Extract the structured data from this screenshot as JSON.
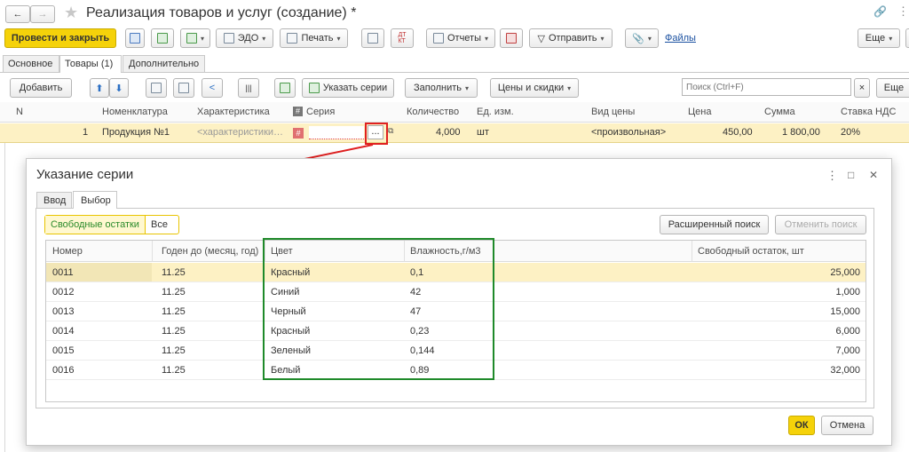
{
  "window": {
    "title": "Реализация товаров и услуг (создание) *"
  },
  "toolbar": {
    "post_close": "Провести и закрыть",
    "edo": "ЭДО",
    "print": "Печать",
    "reports": "Отчеты",
    "send": "Отправить",
    "files": "Файлы",
    "more": "Еще"
  },
  "tabs": [
    "Основное",
    "Товары (1)",
    "Дополнительно"
  ],
  "goods_toolbar": {
    "add": "Добавить",
    "specify_series": "Указать серии",
    "fill": "Заполнить",
    "prices": "Цены и скидки",
    "search_placeholder": "Поиск (Ctrl+F)",
    "clear": "×",
    "more": "Еще"
  },
  "goods_table": {
    "columns": [
      "N",
      "Номенклатура",
      "Характеристика",
      "Серия",
      "Количество",
      "Ед. изм.",
      "Вид цены",
      "Цена",
      "Сумма",
      "Ставка НДС"
    ],
    "row": {
      "n": "1",
      "item": "Продукция №1",
      "characteristic": "<характеристики…",
      "series_btn": "...",
      "qty": "4,000",
      "unit": "шт",
      "price_type": "<произвольная>",
      "price": "450,00",
      "sum": "1 800,00",
      "vat": "20%"
    }
  },
  "dialog": {
    "title": "Указание серии",
    "tabs": [
      "Ввод",
      "Выбор"
    ],
    "filter": [
      "Свободные остатки",
      "Все"
    ],
    "advanced_search": "Расширенный поиск",
    "cancel_search": "Отменить поиск",
    "columns": [
      "Номер",
      "Годен до (месяц, год)",
      "Цвет",
      "Влажность,г/м3",
      "Свободный остаток, шт"
    ],
    "rows": [
      {
        "num": "0011",
        "exp": "11.25",
        "color": "Красный",
        "humidity": "0,1",
        "stock": "25,000"
      },
      {
        "num": "0012",
        "exp": "11.25",
        "color": "Синий",
        "humidity": "42",
        "stock": "1,000"
      },
      {
        "num": "0013",
        "exp": "11.25",
        "color": "Черный",
        "humidity": "47",
        "stock": "15,000"
      },
      {
        "num": "0014",
        "exp": "11.25",
        "color": "Красный",
        "humidity": "0,23",
        "stock": "6,000"
      },
      {
        "num": "0015",
        "exp": "11.25",
        "color": "Зеленый",
        "humidity": "0,144",
        "stock": "7,000"
      },
      {
        "num": "0016",
        "exp": "11.25",
        "color": "Белый",
        "humidity": "0,89",
        "stock": "32,000"
      }
    ],
    "ok": "ОК",
    "cancel": "Отмена",
    "menu": "⋮",
    "maximize": "□",
    "close": "✕"
  },
  "colors": {
    "accent_yellow": "#f5d20a",
    "selected_row": "#fdf1c4",
    "green_frame": "#1f8a2a",
    "red_annotation": "#e02020"
  }
}
